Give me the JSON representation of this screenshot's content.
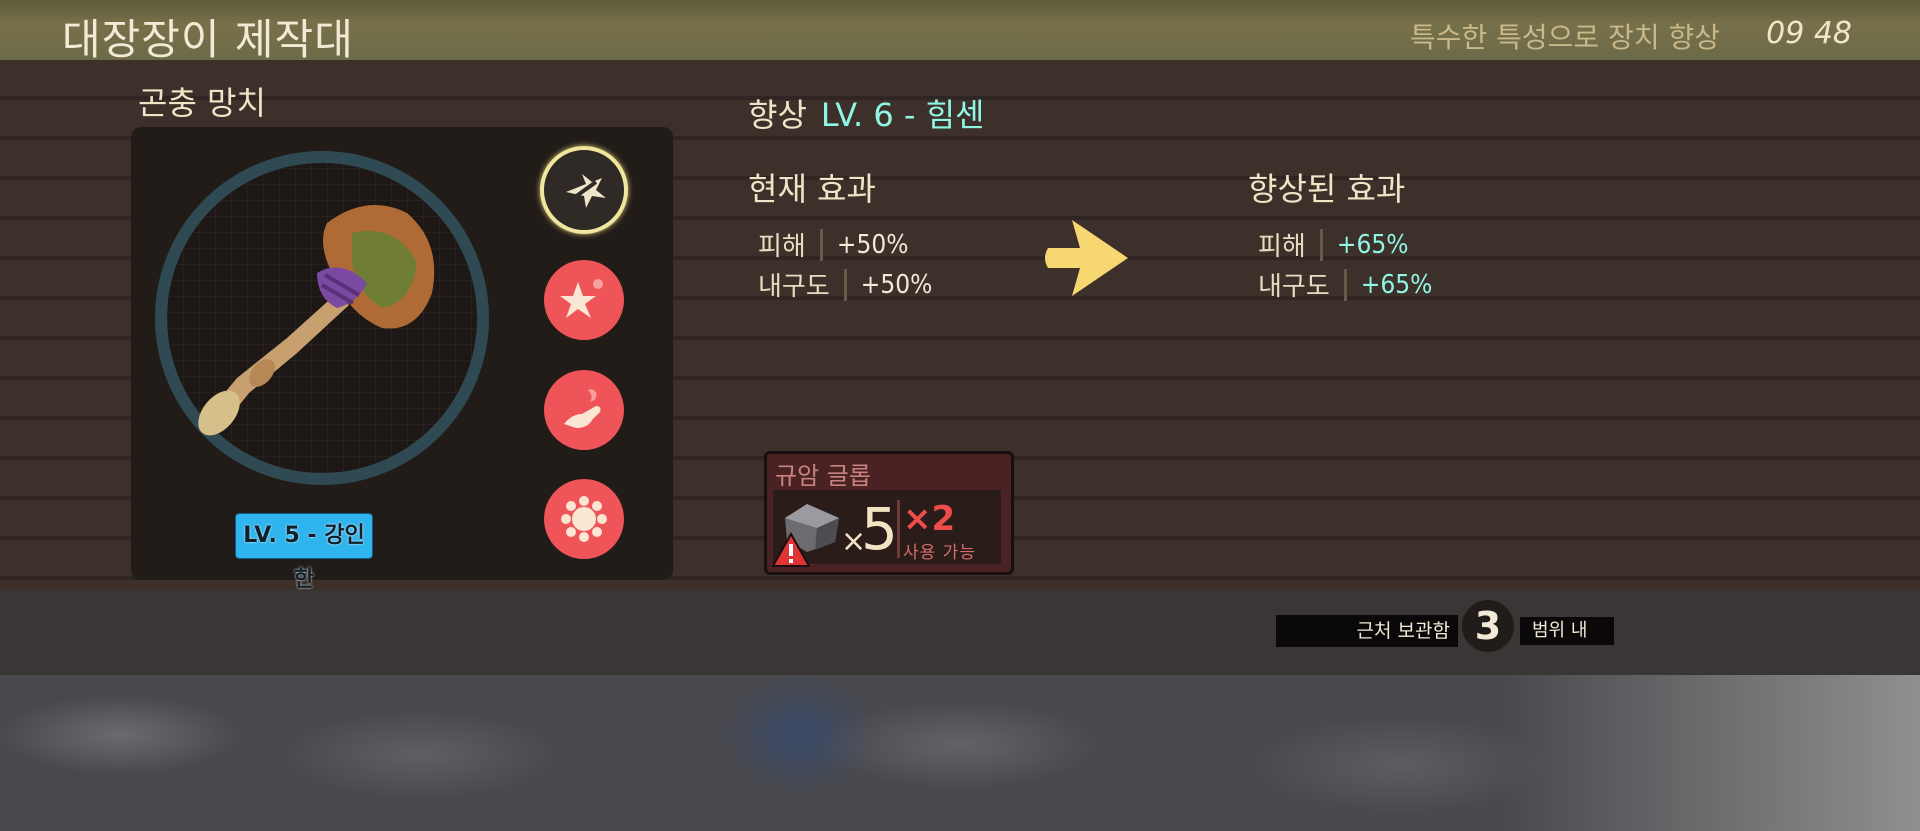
{
  "header": {
    "title": "대장장이 제작대",
    "hint": "특수한 특성으로 장치 향상",
    "clock": "09 48"
  },
  "weapon": {
    "name": "곤충 망치",
    "level_badge": "LV. 5 - 강인한",
    "modifiers": [
      {
        "icon": "strike-icon",
        "selected": true
      },
      {
        "icon": "sparkle-star-icon",
        "selected": false
      },
      {
        "icon": "hand-fire-icon",
        "selected": false
      },
      {
        "icon": "burst-icon",
        "selected": false
      }
    ]
  },
  "upgrade": {
    "prefix": "향상",
    "level": "LV. 6 - 힘센",
    "current": {
      "title": "현재 효과",
      "stats": [
        {
          "name": "피해",
          "value": "+50%"
        },
        {
          "name": "내구도",
          "value": "+50%"
        }
      ]
    },
    "improved": {
      "title": "향상된 효과",
      "stats": [
        {
          "name": "피해",
          "value": "+65%"
        },
        {
          "name": "내구도",
          "value": "+65%"
        }
      ]
    }
  },
  "material": {
    "name": "규암 글롭",
    "owned": "5",
    "times": "×",
    "required": "×2",
    "status": "사용 가능",
    "icon": "quartzite-glob-icon",
    "warning_icon": "warning-icon"
  },
  "footer": {
    "storage_label": "근처 보관함",
    "storage_count": "3",
    "range_label": "범위 내"
  },
  "colors": {
    "accent_teal": "#8ff6e4",
    "level_badge": "#2fb4ee",
    "modifier_red": "#ef5558",
    "warning_red": "#ef4c4c"
  }
}
